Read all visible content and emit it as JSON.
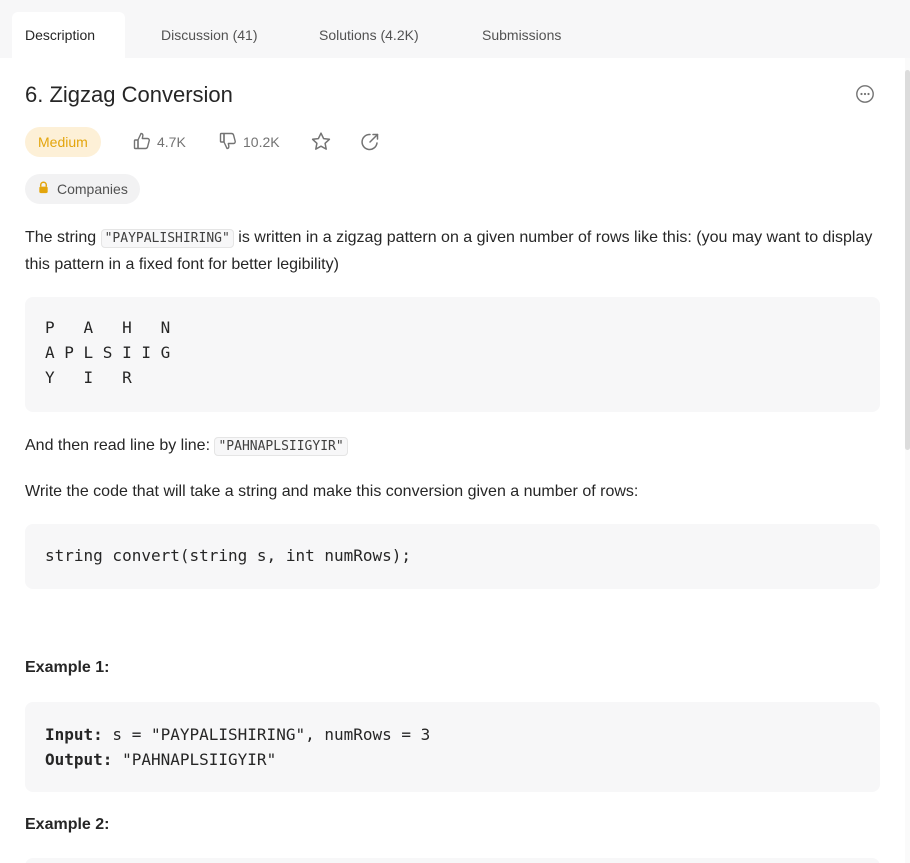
{
  "tabs": [
    {
      "label": "Description",
      "active": true
    },
    {
      "label": "Discussion (41)",
      "active": false
    },
    {
      "label": "Solutions (4.2K)",
      "active": false
    },
    {
      "label": "Submissions",
      "active": false
    }
  ],
  "problem": {
    "title": "6. Zigzag Conversion",
    "difficulty": "Medium",
    "likes": "4.7K",
    "dislikes": "10.2K",
    "companies_label": "Companies"
  },
  "description": {
    "para1_before": "The string ",
    "para1_code": "\"PAYPALISHIRING\"",
    "para1_after": " is written in a zigzag pattern on a given number of rows like this: (you may want to display this pattern in a fixed font for better legibility)",
    "zigzag_lines": [
      "P   A   H   N",
      "A P L S I I G",
      "Y   I   R"
    ],
    "para2_before": "And then read line by line: ",
    "para2_code": "\"PAHNAPLSIIGYIR\"",
    "para3": "Write the code that will take a string and make this conversion given a number of rows:",
    "signature": "string convert(string s, int numRows);"
  },
  "examples": [
    {
      "heading": "Example 1:",
      "input_label": "Input:",
      "input_value": " s = \"PAYPALISHIRING\", numRows = 3",
      "output_label": "Output:",
      "output_value": " \"PAHNAPLSIIGYIR\""
    },
    {
      "heading": "Example 2:"
    }
  ],
  "colors": {
    "difficulty_text": "#e3a50c",
    "difficulty_bg": "#fdf0d7",
    "lock_icon": "#e3a50c"
  },
  "icons": [
    "thumbs-up-icon",
    "thumbs-down-icon",
    "star-icon",
    "share-icon",
    "more-options-icon",
    "lock-icon"
  ]
}
